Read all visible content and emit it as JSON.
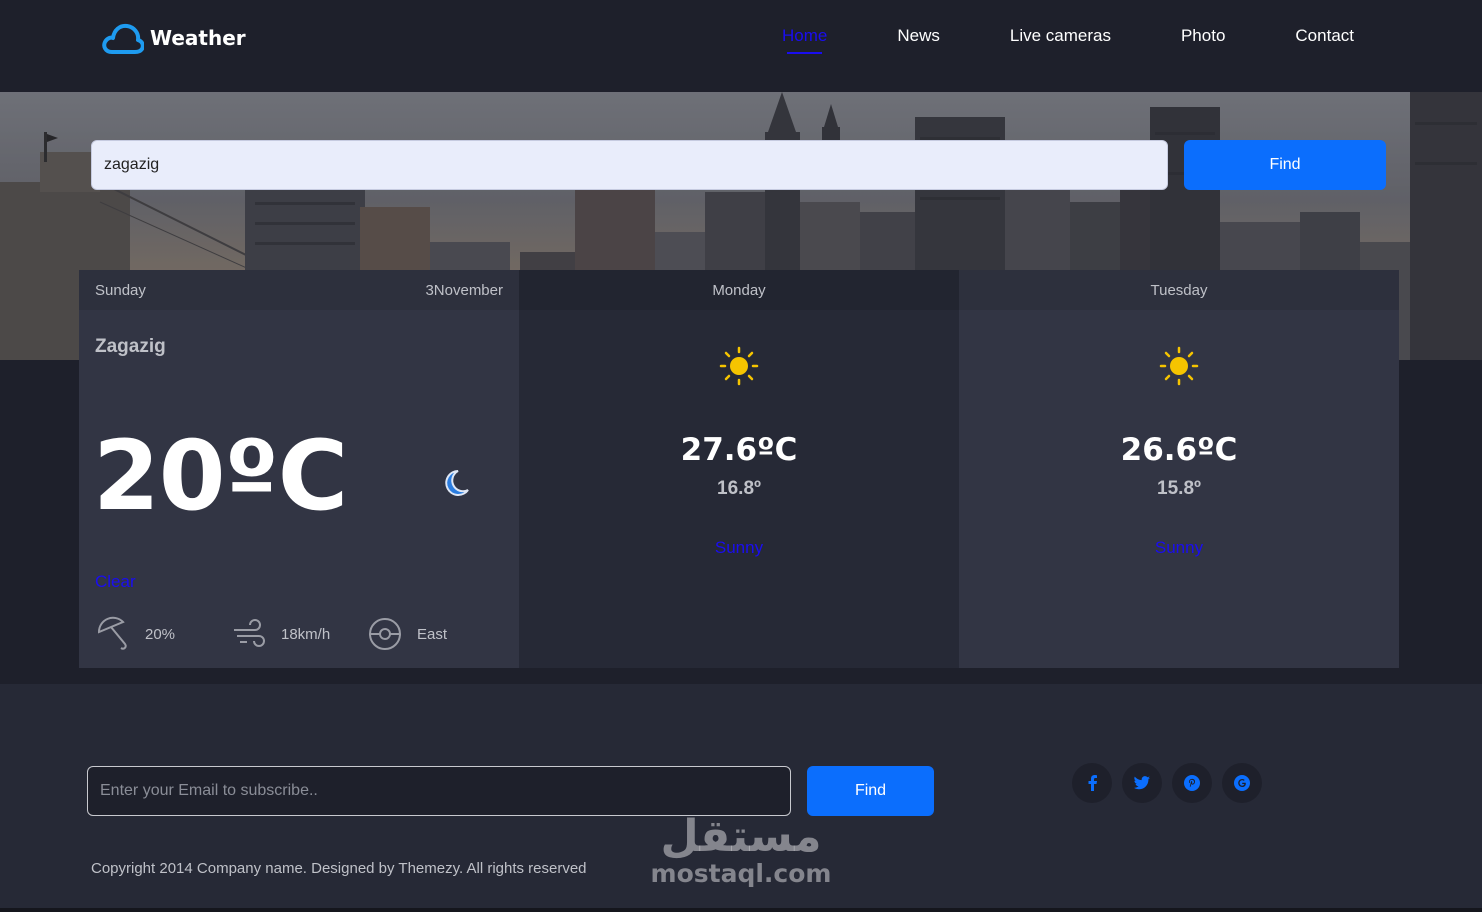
{
  "brand": {
    "name": "Weather",
    "logo_icon": "cloud-icon",
    "accent": "#0b6efd"
  },
  "nav": [
    {
      "label": "Home",
      "active": true
    },
    {
      "label": "News",
      "active": false
    },
    {
      "label": "Live cameras",
      "active": false
    },
    {
      "label": "Photo",
      "active": false
    },
    {
      "label": "Contact",
      "active": false
    }
  ],
  "search": {
    "value": "zagazig",
    "button_label": "Find"
  },
  "today": {
    "day": "Sunday",
    "date": "3November",
    "location": "Zagazig",
    "temperature": "20ºC",
    "icon": "moon-icon",
    "condition": "Clear",
    "humidity": "20%",
    "wind_speed": "18km/h",
    "wind_direction": "East"
  },
  "forecast": [
    {
      "day": "Monday",
      "icon": "sun-icon",
      "max": "27.6ºC",
      "min": "16.8º",
      "condition": "Sunny"
    },
    {
      "day": "Tuesday",
      "icon": "sun-icon",
      "max": "26.6ºC",
      "min": "15.8º",
      "condition": "Sunny"
    }
  ],
  "subscribe": {
    "placeholder": "Enter your Email to subscribe..",
    "button_label": "Find"
  },
  "socials": [
    "facebook-icon",
    "twitter-icon",
    "pinterest-icon",
    "google-icon"
  ],
  "social_glyphs": [
    "f",
    "t",
    "p",
    "g"
  ],
  "copyright": "Copyright 2014 Company name. Designed by Themezy. All rights reserved",
  "watermark": {
    "arabic": "مستقل",
    "latin": "mostaql.com"
  }
}
